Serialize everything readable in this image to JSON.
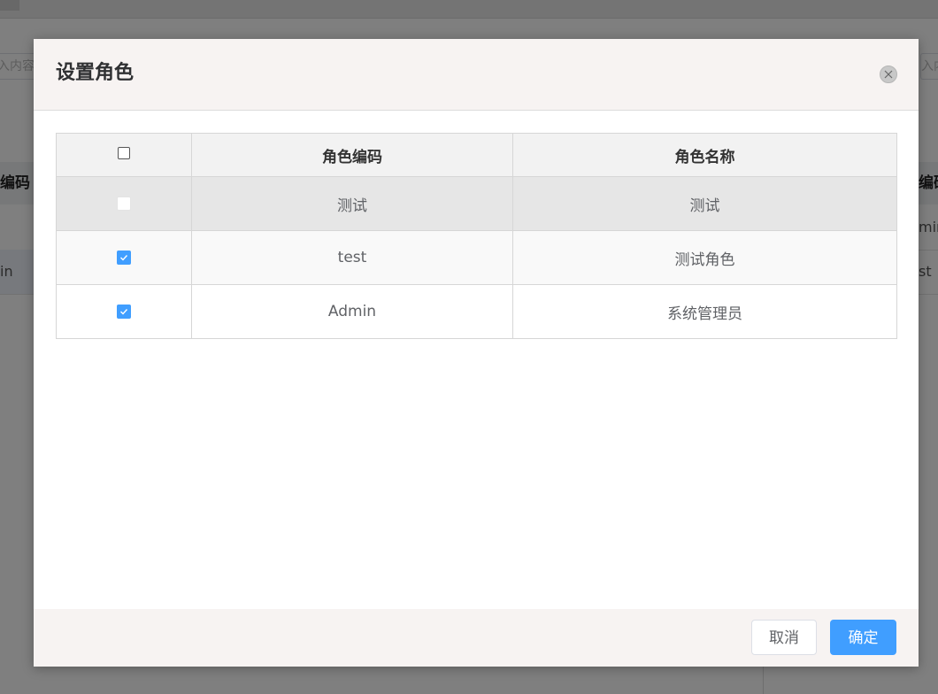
{
  "background": {
    "left_input_text": "入内容",
    "right_input_text": "入内容",
    "left_header_text": "编码",
    "right_header_text": "编码",
    "left_rows": [
      "",
      "in"
    ],
    "right_rows": [
      "min",
      "st"
    ]
  },
  "dialog": {
    "title": "设置角色",
    "close_icon": "close-icon",
    "table": {
      "headers": [
        "",
        "角色编码",
        "角色名称"
      ],
      "rows": [
        {
          "code": "测试",
          "name": "测试",
          "checked": false,
          "disabled": true
        },
        {
          "code": "test",
          "name": "测试角色",
          "checked": true,
          "disabled": false
        },
        {
          "code": "Admin",
          "name": "系统管理员",
          "checked": true,
          "disabled": false
        }
      ]
    },
    "footer": {
      "cancel_label": "取消",
      "confirm_label": "确定"
    }
  },
  "colors": {
    "primary": "#409eff",
    "header_bg": "#f7f3f2",
    "overlay": "rgba(0,0,0,0.5)"
  }
}
